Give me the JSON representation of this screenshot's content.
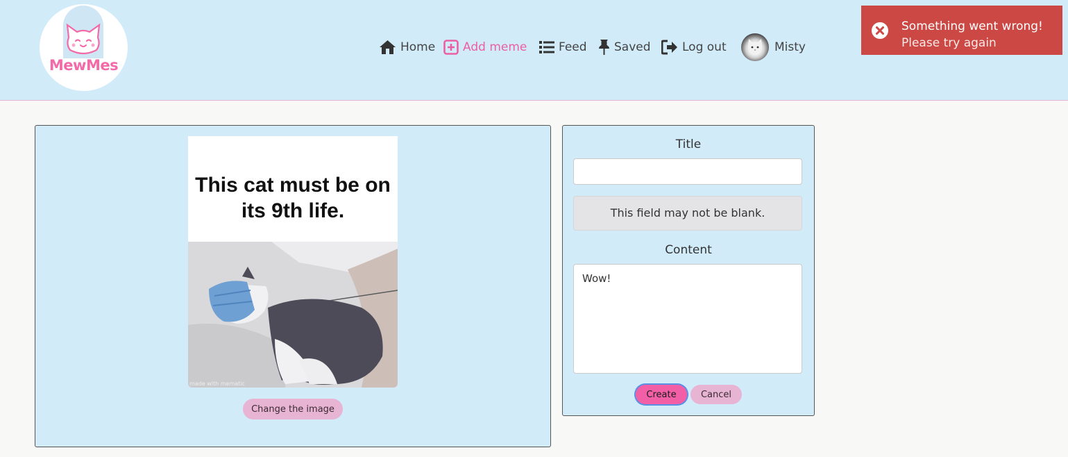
{
  "brand": {
    "name": "MewMes"
  },
  "nav": {
    "items": [
      {
        "label": "Home",
        "icon": "home-icon"
      },
      {
        "label": "Add meme",
        "icon": "plus-square-icon",
        "active": true
      },
      {
        "label": "Feed",
        "icon": "list-icon"
      },
      {
        "label": "Saved",
        "icon": "thumbtack-icon"
      },
      {
        "label": "Log out",
        "icon": "sign-out-icon"
      }
    ],
    "user": {
      "name": "Misty"
    }
  },
  "toast": {
    "title": "Something went wrong!",
    "message": "Please try again",
    "icon": "error-circle-icon",
    "color": "#cc4844"
  },
  "image_panel": {
    "meme_caption": "This cat must be on its 9th life.",
    "watermark": "made with mematic",
    "change_button": "Change the image"
  },
  "form": {
    "title_label": "Title",
    "title_value": "",
    "title_error": "This field may not be blank.",
    "content_label": "Content",
    "content_value": "Wow!",
    "create_button": "Create",
    "cancel_button": "Cancel"
  },
  "colors": {
    "navbar_bg": "#d1ebf9",
    "accent_pink": "#ec5fa1",
    "button_pink": "#e8b4d4",
    "page_bg": "#f8f8f6"
  }
}
